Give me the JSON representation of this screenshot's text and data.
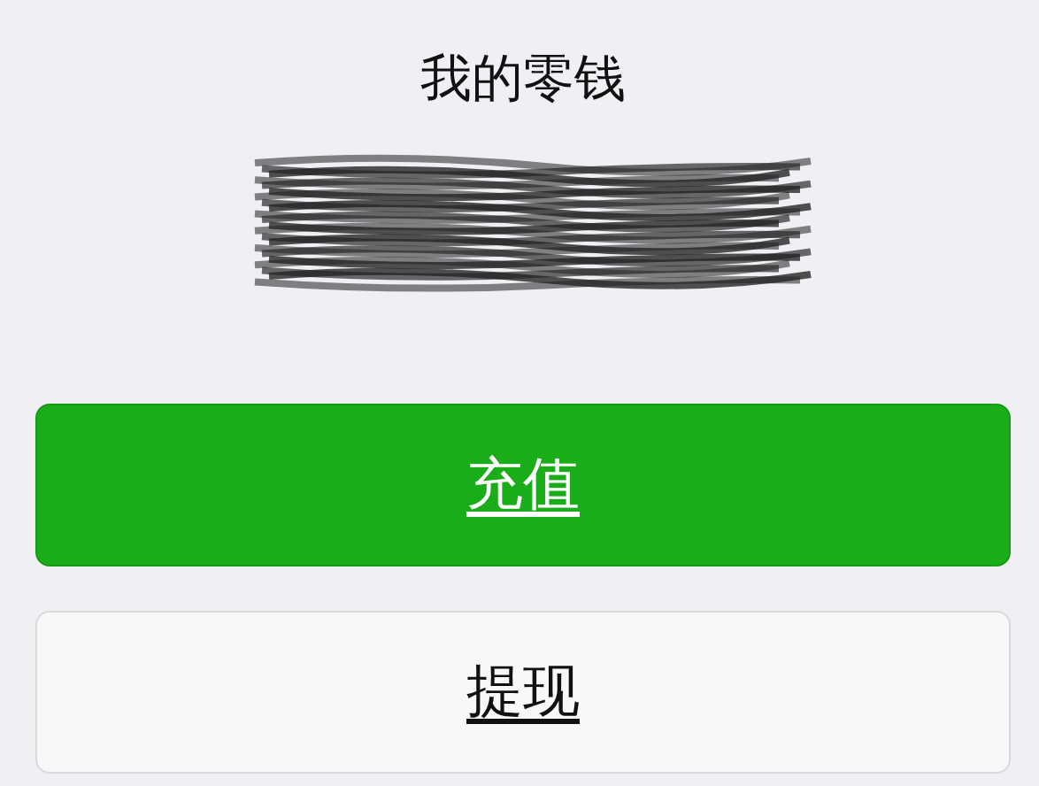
{
  "title": "我的零钱",
  "balance": {
    "redacted": true
  },
  "buttons": [
    {
      "label": "充值",
      "kind": "primary"
    },
    {
      "label": "提现",
      "kind": "default"
    }
  ]
}
